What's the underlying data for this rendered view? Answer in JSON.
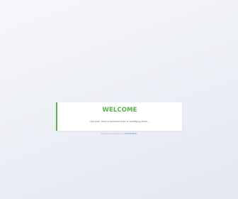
{
  "card": {
    "title": "WELCOME",
    "message": "Not sure, there's someone from or modifying items..."
  },
  "footer": {
    "text": "Powered and made by",
    "separator": "|",
    "link_label": "PHOTOSITE"
  },
  "colors": {
    "accent_green": "#56b449",
    "link_blue": "#4a90d9"
  }
}
